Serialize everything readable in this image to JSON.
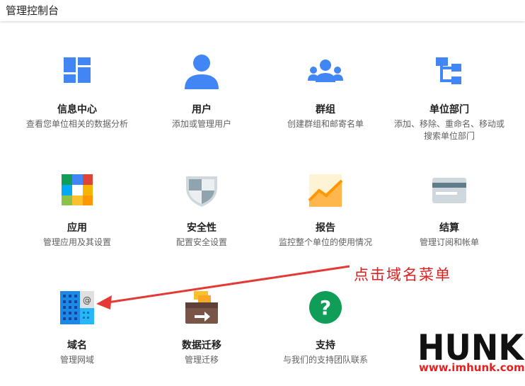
{
  "header": {
    "title": "管理控制台"
  },
  "tiles": [
    {
      "label": "信息中心",
      "desc": "查看您单位相关的数据分析"
    },
    {
      "label": "用户",
      "desc": "添加或管理用户"
    },
    {
      "label": "群组",
      "desc": "创建群组和邮寄名单"
    },
    {
      "label": "单位部门",
      "desc": "添加、移除、重命名、移动或搜索单位部门"
    },
    {
      "label": "应用",
      "desc": "管理应用及其设置"
    },
    {
      "label": "安全性",
      "desc": "配置安全设置"
    },
    {
      "label": "报告",
      "desc": "监控整个单位的使用情况"
    },
    {
      "label": "结算",
      "desc": "管理订阅和帐单"
    },
    {
      "label": "域名",
      "desc": "管理网域"
    },
    {
      "label": "数据迁移",
      "desc": "管理迁移"
    },
    {
      "label": "支持",
      "desc": "与我们的支持团队联系"
    }
  ],
  "annotation": {
    "text": "点击域名菜单",
    "color": "#e02020"
  },
  "watermark": {
    "logo_text": "HUNK",
    "url": "www.imhunk.com"
  },
  "colors": {
    "primary_blue": "#4285f4",
    "green": "#0f9d58",
    "red_accent": "#e62020"
  }
}
